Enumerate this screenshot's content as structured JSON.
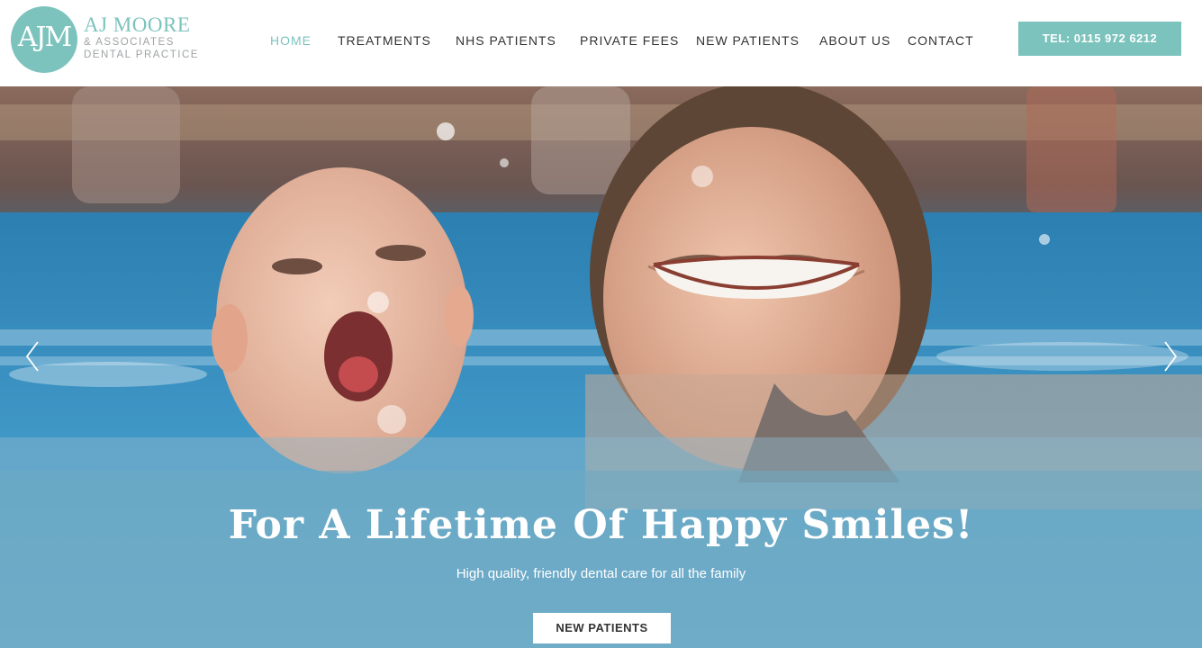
{
  "logo": {
    "mark": "AJM",
    "name": "AJ MOORE",
    "sub_line1": "& ASSOCIATES",
    "sub_line2": "DENTAL PRACTICE"
  },
  "nav": {
    "items": [
      {
        "label": "HOME",
        "active": true
      },
      {
        "label": "TREATMENTS",
        "active": false
      },
      {
        "label": "NHS PATIENTS",
        "active": false
      },
      {
        "label": "PRIVATE FEES",
        "active": false
      },
      {
        "label": "NEW PATIENTS",
        "active": false
      },
      {
        "label": "ABOUT US",
        "active": false
      },
      {
        "label": "CONTACT",
        "active": false
      }
    ]
  },
  "header": {
    "tel_label": "TEL: 0115 972 6212"
  },
  "hero": {
    "title": "For A Lifetime Of Happy Smiles!",
    "subtitle": "High quality, friendly dental care for all the family",
    "button_label": "NEW PATIENTS",
    "prev_icon": "chevron-left-icon",
    "next_icon": "chevron-right-icon"
  },
  "colors": {
    "accent": "#7cc3bd",
    "nav_text": "#333333",
    "caption_overlay": "#6eaac3"
  }
}
